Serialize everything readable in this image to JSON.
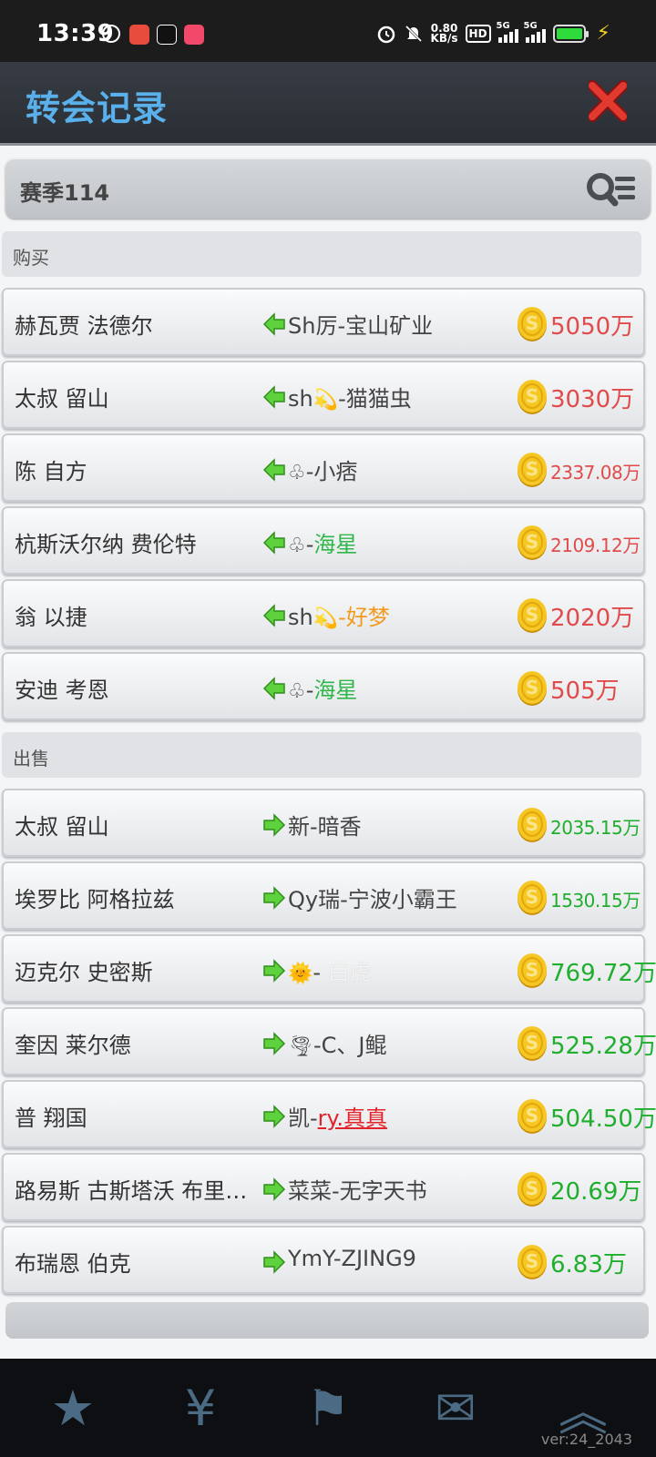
{
  "statusbar": {
    "time": "13:39",
    "net_speed": "0.80",
    "net_unit": "KB/s",
    "hd": "HD",
    "sig1": "5G",
    "sig2": "5G"
  },
  "header": {
    "title": "转会记录"
  },
  "season": {
    "label": "赛季114"
  },
  "buy": {
    "label": "购买",
    "rows": [
      {
        "player": "赫瓦贾 法德尔",
        "club_prefix": "Sh厉-",
        "club_name": "宝山矿业",
        "fee": "5050万"
      },
      {
        "player": "太叔 留山",
        "club_prefix": "sh",
        "club_glyph": "💫",
        "club_sep": "-",
        "club_name": "猫猫虫",
        "fee": "3030万"
      },
      {
        "player": "陈 自方",
        "club_glyph": "♧",
        "club_sep": "-",
        "club_name": "小痞",
        "fee": "2337.08万"
      },
      {
        "player": "杭斯沃尔纳 费伦特",
        "club_glyph": "♧",
        "club_sep": "-",
        "club_name": "海星",
        "fee": "2109.12万"
      },
      {
        "player": "翁 以捷",
        "club_prefix": "sh",
        "club_glyph": "💫",
        "club_sep": "-",
        "club_name": "好梦",
        "fee": "2020万"
      },
      {
        "player": "安迪 考恩",
        "club_glyph": "♧",
        "club_sep": "-",
        "club_name": "海星",
        "fee": "505万"
      }
    ]
  },
  "sell": {
    "label": "出售",
    "rows": [
      {
        "player": "太叔 留山",
        "club_prefix": "新-",
        "club_name": "暗香",
        "fee": "2035.15万"
      },
      {
        "player": "埃罗比 阿格拉兹",
        "club_prefix": "Qy瑞-",
        "club_name": "宁波小霸王",
        "fee": "1530.15万"
      },
      {
        "player": "迈克尔 史密斯",
        "club_glyph": "🌞",
        "club_sep": "- ",
        "club_name": "白虎",
        "fee": "769.72万"
      },
      {
        "player": "奎因 莱尔德",
        "club_glyph": "🌪",
        "club_sep": "-",
        "club_name": "C、J鲲",
        "fee": "525.28万"
      },
      {
        "player": "普 翔国",
        "club_prefix": "凯-",
        "club_name": "ry.真真",
        "fee": "504.50万"
      },
      {
        "player": "路易斯 古斯塔沃 布里…",
        "club_prefix": "菜菜-",
        "club_name": "无字天书",
        "fee": "20.69万"
      },
      {
        "player": "布瑞恩 伯克",
        "club_prefix": "YmY-",
        "club_name": "ZJING9",
        "fee": "6.83万"
      }
    ]
  },
  "footer": {
    "version": "ver:24_2043"
  },
  "colors": {
    "accent": "#5ab0ea",
    "buy_fee": "#e04b4b",
    "sell_fee": "#1fae2e",
    "club_green": "#2fb74c",
    "club_orange": "#f39a1c"
  },
  "icons": [
    "alarm-icon",
    "mute-icon",
    "battery-icon",
    "close-icon",
    "search-list-icon",
    "arrow-left-icon",
    "arrow-right-icon",
    "coin-icon"
  ]
}
